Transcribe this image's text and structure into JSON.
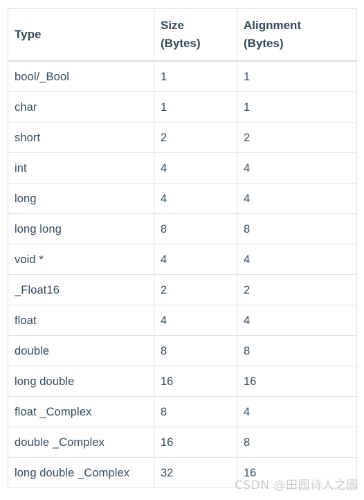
{
  "table": {
    "columns": [
      {
        "key": "type",
        "label": "Type"
      },
      {
        "key": "size",
        "label": "Size\n(Bytes)"
      },
      {
        "key": "alignment",
        "label": "Alignment\n(Bytes)"
      }
    ],
    "rows": [
      {
        "type": "bool/_Bool",
        "size": "1",
        "alignment": "1"
      },
      {
        "type": "char",
        "size": "1",
        "alignment": "1"
      },
      {
        "type": "short",
        "size": "2",
        "alignment": "2"
      },
      {
        "type": "int",
        "size": "4",
        "alignment": "4"
      },
      {
        "type": "long",
        "size": "4",
        "alignment": "4"
      },
      {
        "type": "long long",
        "size": "8",
        "alignment": "8"
      },
      {
        "type": "void *",
        "size": "4",
        "alignment": "4"
      },
      {
        "type": "_Float16",
        "size": "2",
        "alignment": "2"
      },
      {
        "type": "float",
        "size": "4",
        "alignment": "4"
      },
      {
        "type": "double",
        "size": "8",
        "alignment": "8"
      },
      {
        "type": "long double",
        "size": "16",
        "alignment": "16"
      },
      {
        "type": "float _Complex",
        "size": "8",
        "alignment": "4"
      },
      {
        "type": "double _Complex",
        "size": "16",
        "alignment": "8"
      },
      {
        "type": "long double _Complex",
        "size": "32",
        "alignment": "16"
      }
    ]
  },
  "watermark": {
    "text": "CSDN @田园诗人之园"
  },
  "colors": {
    "text": "#34495e",
    "border": "#e3e3e5",
    "header_border": "#dddddf",
    "watermark": "#c9c9cb",
    "background": "#ffffff"
  }
}
